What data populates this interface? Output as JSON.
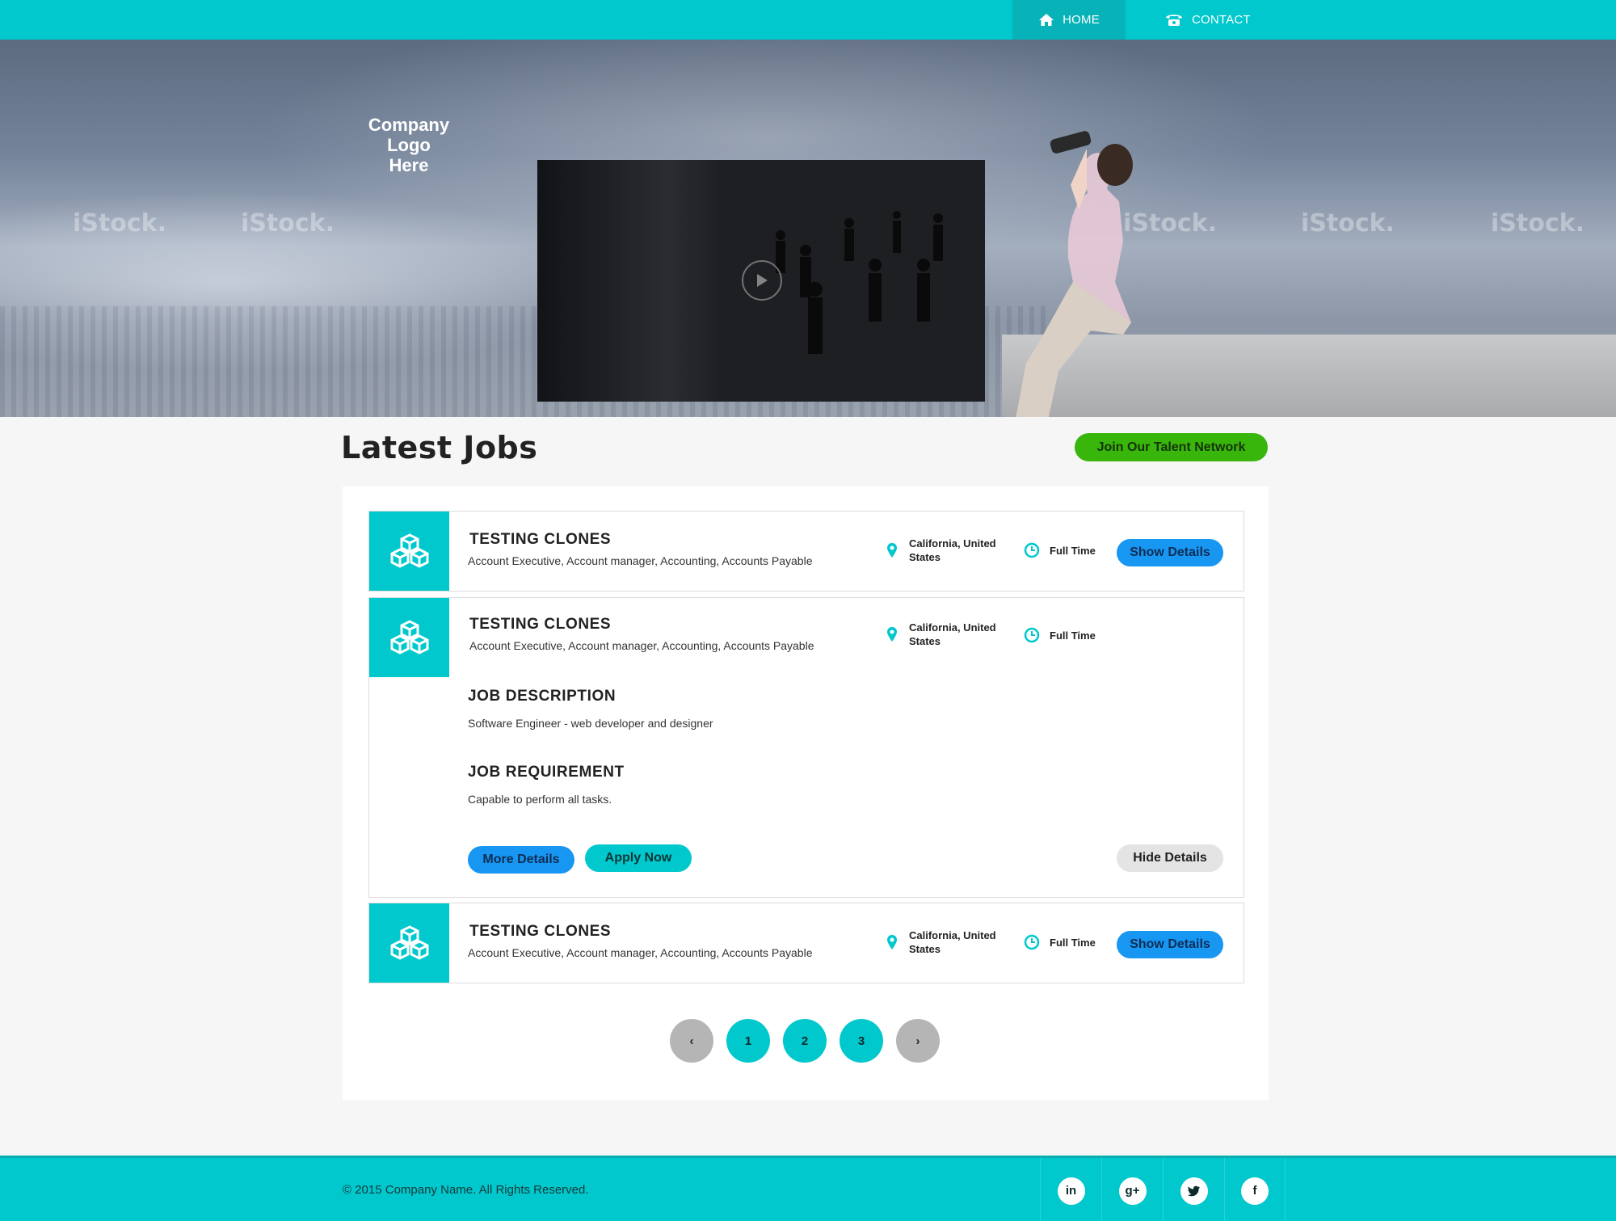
{
  "nav": {
    "home_label": "HOME",
    "contact_label": "CONTACT",
    "home_icon": "home-icon",
    "contact_icon": "phone-icon"
  },
  "hero": {
    "logo_text": "Company Logo Here",
    "watermark": "iStock.",
    "video_icon": "play-icon"
  },
  "section": {
    "title": "Latest Jobs",
    "talent_button": "Join Our Talent Network"
  },
  "jobs": [
    {
      "title": "TESTING CLONES",
      "tags": "Account Executive, Account manager, Accounting, Accounts Payable",
      "location": "California, United States",
      "type": "Full Time",
      "button": "Show Details"
    },
    {
      "title": "TESTING CLONES",
      "tags": "Account Executive, Account manager, Accounting, Accounts Payable",
      "location": "California, United States",
      "type": "Full Time",
      "description_heading": "JOB DESCRIPTION",
      "description": "Software Engineer - web developer and designer",
      "requirement_heading": "JOB REQUIREMENT",
      "requirement": "Capable to perform all tasks.",
      "more_button": "More Details",
      "apply_button": "Apply Now",
      "hide_button": "Hide Details"
    },
    {
      "title": "TESTING CLONES",
      "tags": "Account Executive, Account manager, Accounting, Accounts Payable",
      "location": "California, United States",
      "type": "Full Time",
      "button": "Show Details"
    }
  ],
  "pagination": {
    "prev": "‹",
    "pages": [
      "1",
      "2",
      "3"
    ],
    "next": "›"
  },
  "footer": {
    "copyright": "© 2015 Company Name. All Rights Reserved.",
    "socials": [
      {
        "label": "in",
        "icon": "linkedin-icon"
      },
      {
        "label": "g+",
        "icon": "google-plus-icon"
      },
      {
        "label": "",
        "icon": "twitter-icon"
      },
      {
        "label": "f",
        "icon": "facebook-icon"
      }
    ]
  },
  "colors": {
    "primary": "#00c8cc",
    "blue_button": "#1796f2",
    "green_button": "#39b60b",
    "grey_button": "#e4e4e4"
  }
}
